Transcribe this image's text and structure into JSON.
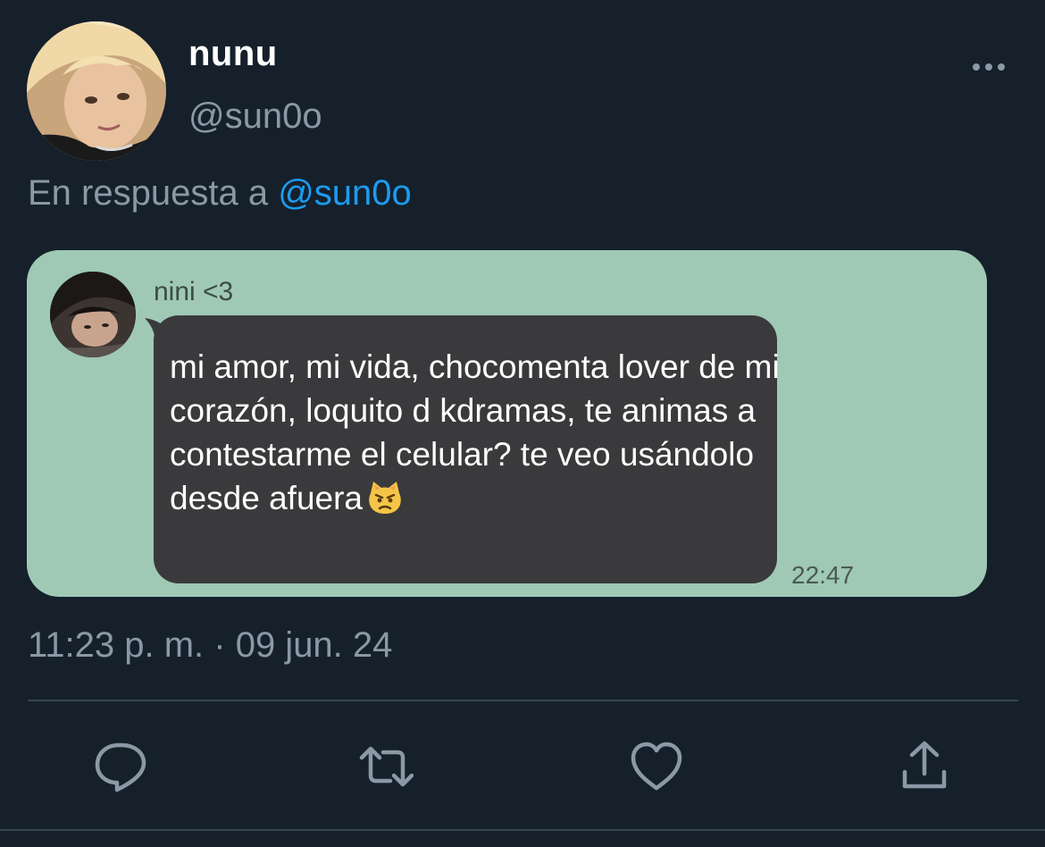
{
  "author": {
    "display_name": "nunu",
    "handle": "@sun0o",
    "avatar_icon": "profile-photo"
  },
  "reply_context": {
    "prefix": "En respuesta a",
    "mention": "@sun0o"
  },
  "media": {
    "background_color": "#9fc9b5",
    "chat": {
      "sender_name": "nini <3",
      "message": "mi amor, mi vida, chocomenta lover de mi corazón, loquito d kdramas, te animas a contestarme el celular? te veo usándolo desde afuera",
      "emoji": "pouting-cat-emoji",
      "time": "22:47",
      "bubble_color": "#3a3a3c"
    }
  },
  "timestamp": "11:23 p. m. · 09 jun. 24",
  "actions": {
    "reply_icon": "comment-icon",
    "retweet_icon": "retweet-icon",
    "like_icon": "heart-icon",
    "share_icon": "share-icon"
  },
  "colors": {
    "background": "#15202b",
    "secondary_text": "#8b98a5",
    "accent": "#1d9bf0",
    "divider": "#38444d"
  }
}
